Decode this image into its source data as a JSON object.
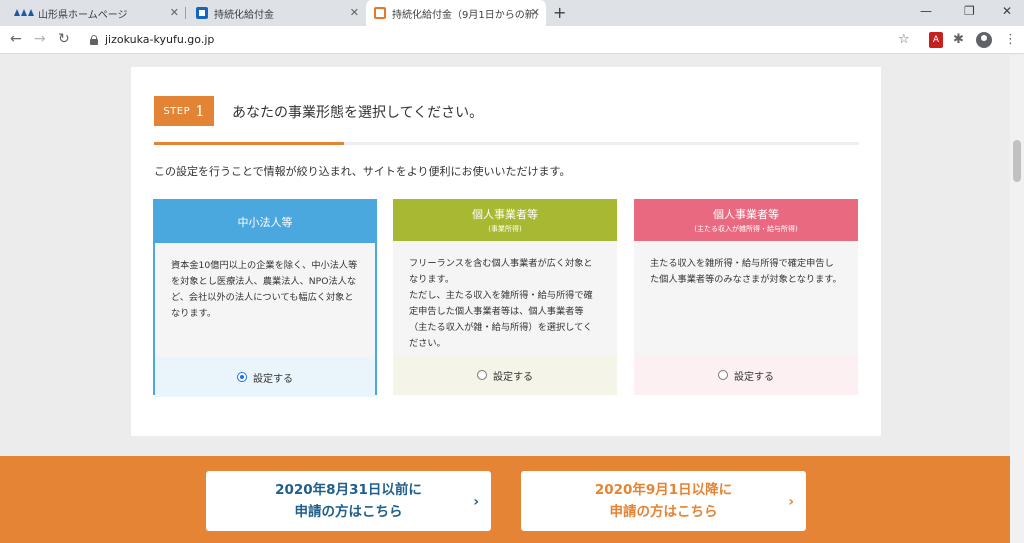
{
  "browser": {
    "tabs": [
      {
        "title": "山形県ホームページ",
        "icon": "yamagata-logo-icon"
      },
      {
        "title": "持続化給付金",
        "icon": "jizokuka-favicon-icon"
      },
      {
        "title": "持続化給付金（9月1日からの新規",
        "icon": "jizokuka-new-favicon-icon"
      }
    ],
    "close_glyph": "✕",
    "new_tab_glyph": "+",
    "url": "jizokuka-kyufu.go.jp"
  },
  "step": {
    "label": "STEP",
    "number": "1",
    "title": "あなたの事業形態を選択してください。",
    "progress": 0.27
  },
  "description": "この設定を行うことで情報が絞り込まれ、サイトをより便利にお使いいただけます。",
  "options": [
    {
      "title": "中小法人等",
      "subtitle": "",
      "body": "資本金10億円以上の企業を除く、中小法人等を対象とし医療法人、農業法人、NPO法人など、会社以外の法人についても幅広く対象となります。",
      "radio_label": "設定する",
      "selected": true,
      "color": "#4aa8de"
    },
    {
      "title": "個人事業者等",
      "subtitle": "(事業所得)",
      "body": "フリーランスを含む個人事業者が広く対象となります。\nただし、主たる収入を雑所得・給与所得で確定申告した個人事業者等は、個人事業者等（主たる収入が雑・給与所得）を選択してください。",
      "radio_label": "設定する",
      "selected": false,
      "color": "#a8b832"
    },
    {
      "title": "個人事業者等",
      "subtitle": "(主たる収入が雑所得・給与所得)",
      "body": "主たる収入を雑所得・給与所得で確定申告した個人事業者等のみなさまが対象となります。",
      "radio_label": "設定する",
      "selected": false,
      "color": "#e96a80"
    }
  ],
  "banner": {
    "before": {
      "line1": "2020年8月31日以前に",
      "line2": "申請の方はこちら",
      "chevron": "›"
    },
    "after": {
      "line1": "2020年9月1日以降に",
      "line2": "申請の方はこちら",
      "chevron": "›"
    },
    "color": "#e48434"
  }
}
